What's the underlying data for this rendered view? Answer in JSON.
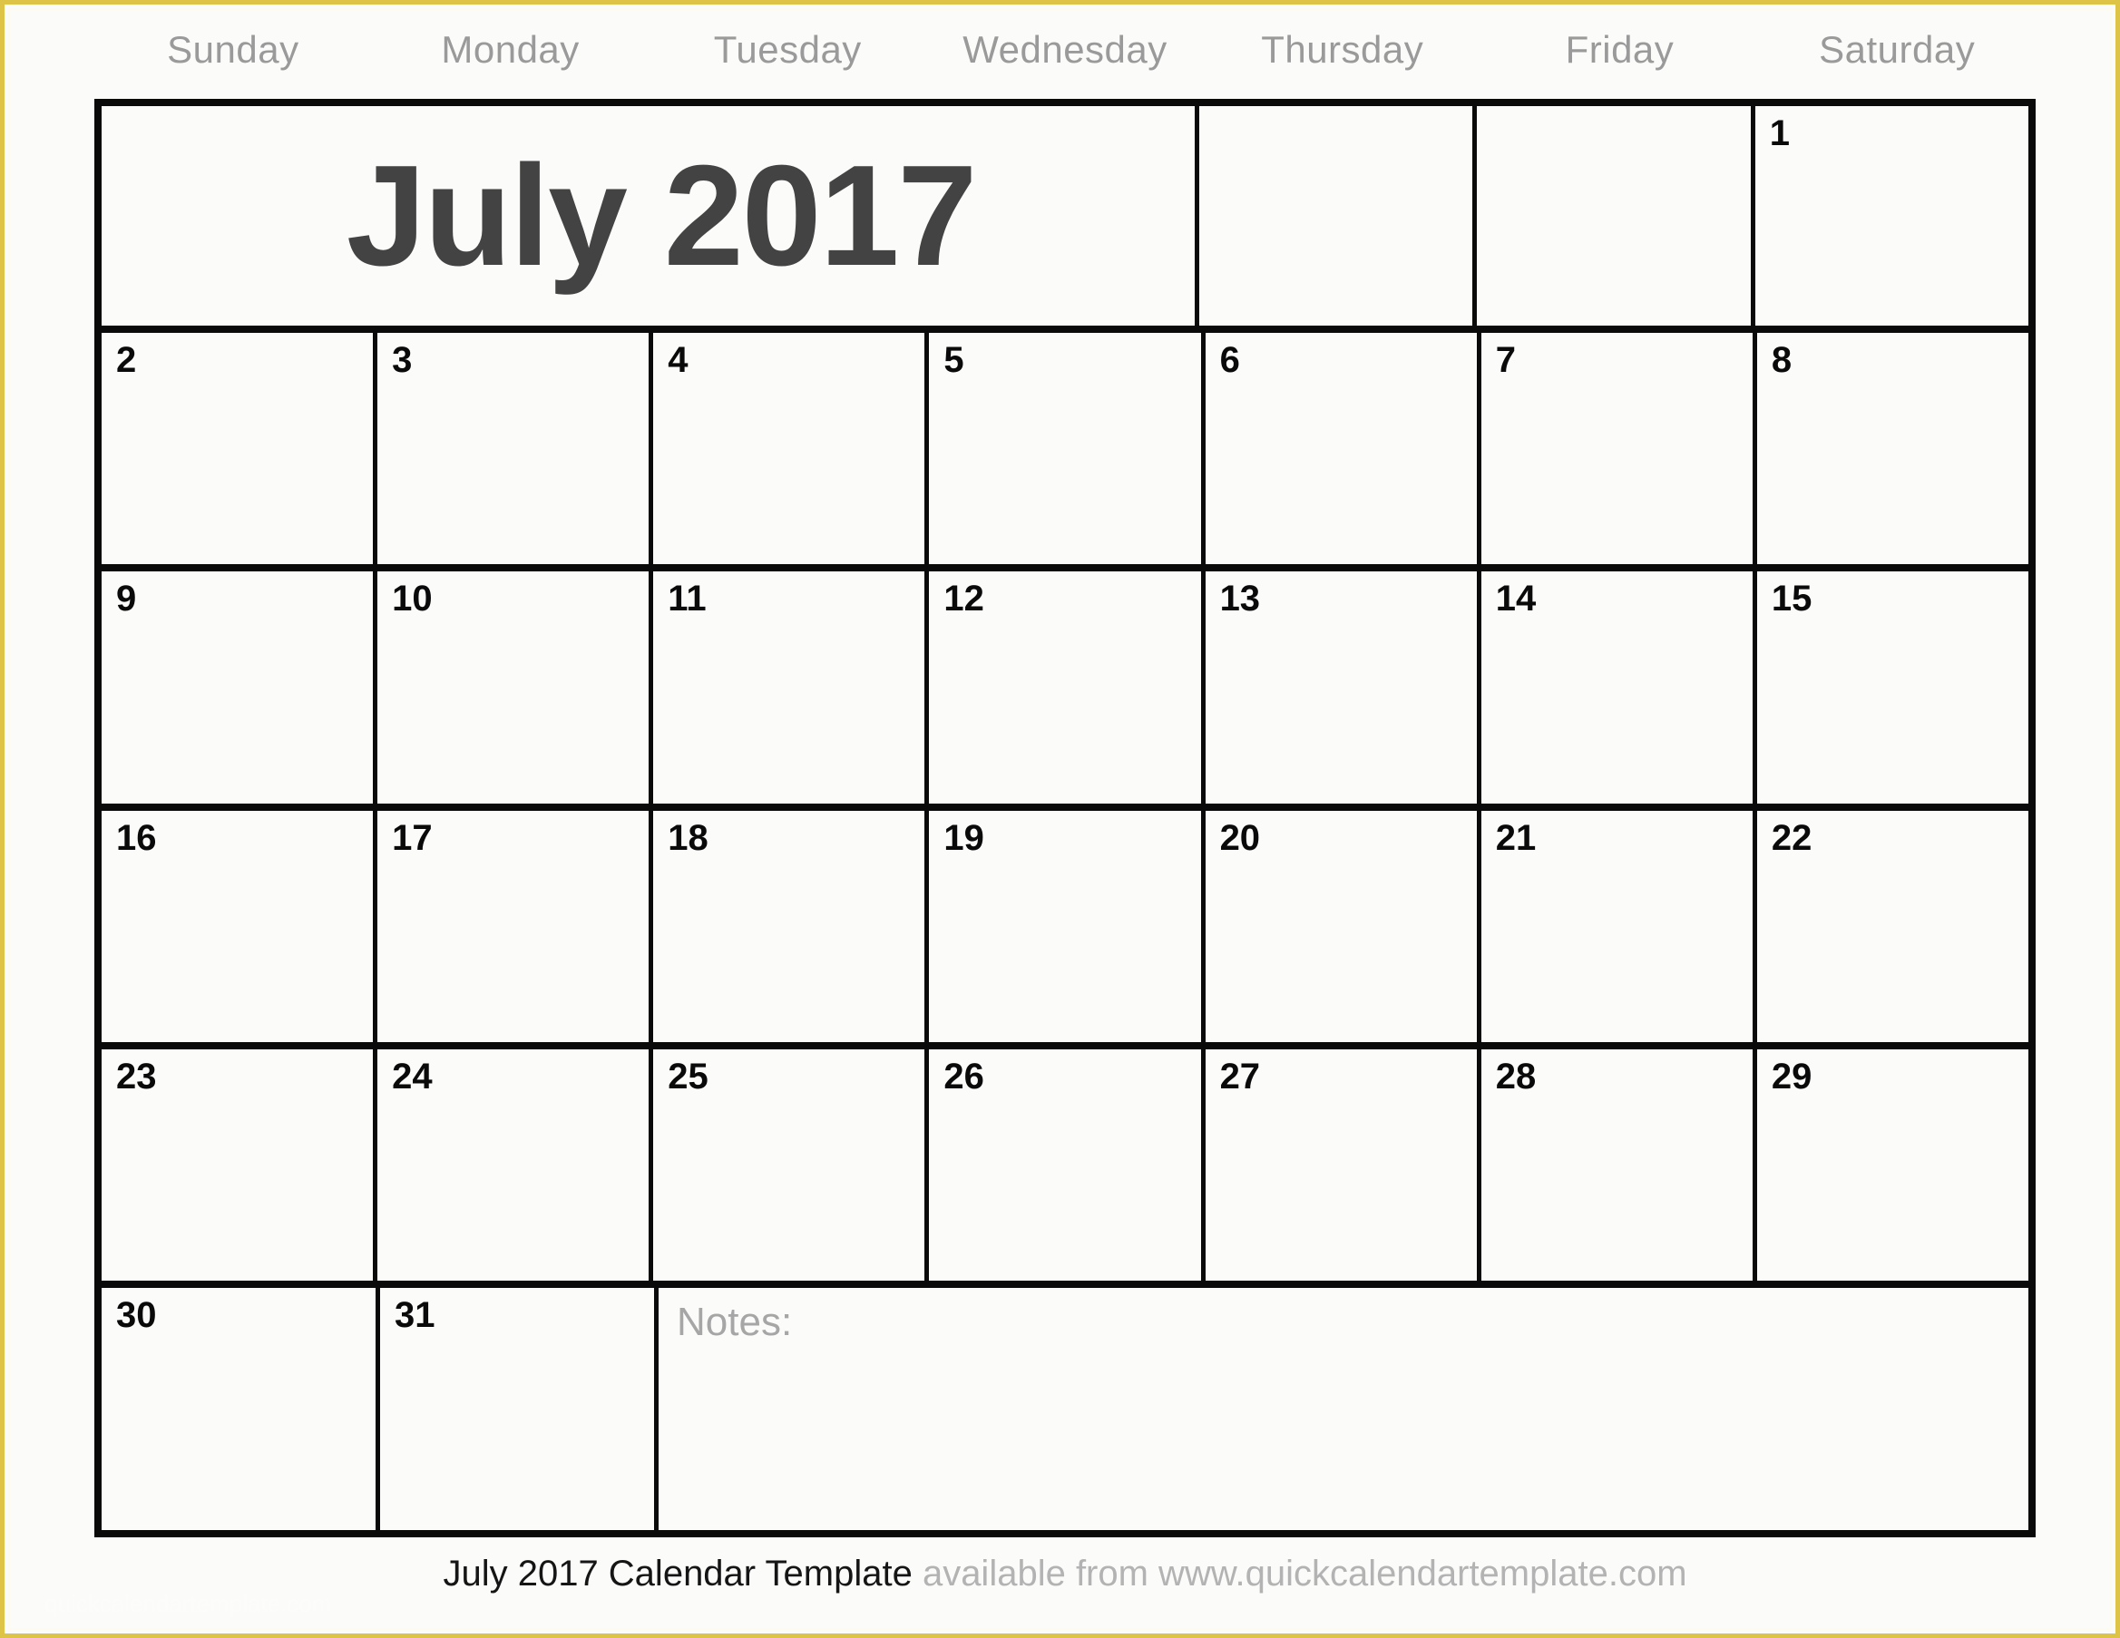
{
  "document": {
    "type": "printable-monthly-calendar",
    "page_border_color": "#ddc447",
    "page_background": "#fbfbfa",
    "grid_line_color": "#0a0a0a"
  },
  "weekdays": [
    "Sunday",
    "Monday",
    "Tuesday",
    "Wednesday",
    "Thursday",
    "Friday",
    "Saturday"
  ],
  "title": {
    "text": "July 2017",
    "color": "#434343"
  },
  "notes": {
    "label": "Notes:",
    "color": "#a6a6a6"
  },
  "weeks": [
    {
      "title_cell": "July 2017",
      "cells": [
        "",
        "",
        "1"
      ]
    },
    {
      "cells": [
        "2",
        "3",
        "4",
        "5",
        "6",
        "7",
        "8"
      ]
    },
    {
      "cells": [
        "9",
        "10",
        "11",
        "12",
        "13",
        "14",
        "15"
      ]
    },
    {
      "cells": [
        "16",
        "17",
        "18",
        "19",
        "20",
        "21",
        "22"
      ]
    },
    {
      "cells": [
        "23",
        "24",
        "25",
        "26",
        "27",
        "28",
        "29"
      ]
    },
    {
      "cells": [
        "30",
        "31"
      ]
    }
  ],
  "footer": {
    "strong_text": "July 2017 Calendar Template",
    "muted_text": " available from www.quickcalendartemplate.com",
    "strong_color": "#151515",
    "muted_color": "#b3b3b3"
  },
  "watermark": {
    "text": "quickcalendartemplate.com"
  }
}
